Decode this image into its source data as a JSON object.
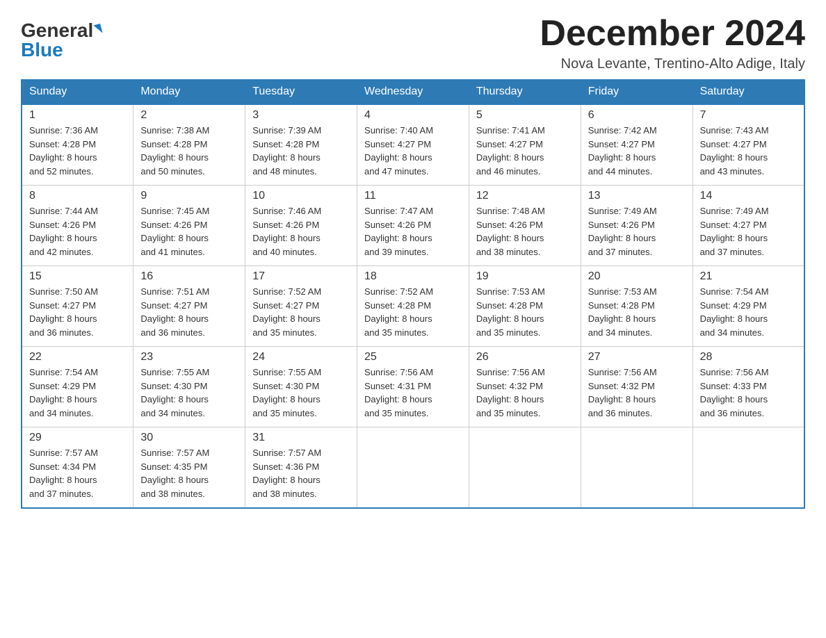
{
  "header": {
    "logo_general": "General",
    "logo_blue": "Blue",
    "month_title": "December 2024",
    "location": "Nova Levante, Trentino-Alto Adige, Italy"
  },
  "days_of_week": [
    "Sunday",
    "Monday",
    "Tuesday",
    "Wednesday",
    "Thursday",
    "Friday",
    "Saturday"
  ],
  "weeks": [
    [
      {
        "day": "1",
        "sunrise": "7:36 AM",
        "sunset": "4:28 PM",
        "daylight": "8 hours and 52 minutes."
      },
      {
        "day": "2",
        "sunrise": "7:38 AM",
        "sunset": "4:28 PM",
        "daylight": "8 hours and 50 minutes."
      },
      {
        "day": "3",
        "sunrise": "7:39 AM",
        "sunset": "4:28 PM",
        "daylight": "8 hours and 48 minutes."
      },
      {
        "day": "4",
        "sunrise": "7:40 AM",
        "sunset": "4:27 PM",
        "daylight": "8 hours and 47 minutes."
      },
      {
        "day": "5",
        "sunrise": "7:41 AM",
        "sunset": "4:27 PM",
        "daylight": "8 hours and 46 minutes."
      },
      {
        "day": "6",
        "sunrise": "7:42 AM",
        "sunset": "4:27 PM",
        "daylight": "8 hours and 44 minutes."
      },
      {
        "day": "7",
        "sunrise": "7:43 AM",
        "sunset": "4:27 PM",
        "daylight": "8 hours and 43 minutes."
      }
    ],
    [
      {
        "day": "8",
        "sunrise": "7:44 AM",
        "sunset": "4:26 PM",
        "daylight": "8 hours and 42 minutes."
      },
      {
        "day": "9",
        "sunrise": "7:45 AM",
        "sunset": "4:26 PM",
        "daylight": "8 hours and 41 minutes."
      },
      {
        "day": "10",
        "sunrise": "7:46 AM",
        "sunset": "4:26 PM",
        "daylight": "8 hours and 40 minutes."
      },
      {
        "day": "11",
        "sunrise": "7:47 AM",
        "sunset": "4:26 PM",
        "daylight": "8 hours and 39 minutes."
      },
      {
        "day": "12",
        "sunrise": "7:48 AM",
        "sunset": "4:26 PM",
        "daylight": "8 hours and 38 minutes."
      },
      {
        "day": "13",
        "sunrise": "7:49 AM",
        "sunset": "4:26 PM",
        "daylight": "8 hours and 37 minutes."
      },
      {
        "day": "14",
        "sunrise": "7:49 AM",
        "sunset": "4:27 PM",
        "daylight": "8 hours and 37 minutes."
      }
    ],
    [
      {
        "day": "15",
        "sunrise": "7:50 AM",
        "sunset": "4:27 PM",
        "daylight": "8 hours and 36 minutes."
      },
      {
        "day": "16",
        "sunrise": "7:51 AM",
        "sunset": "4:27 PM",
        "daylight": "8 hours and 36 minutes."
      },
      {
        "day": "17",
        "sunrise": "7:52 AM",
        "sunset": "4:27 PM",
        "daylight": "8 hours and 35 minutes."
      },
      {
        "day": "18",
        "sunrise": "7:52 AM",
        "sunset": "4:28 PM",
        "daylight": "8 hours and 35 minutes."
      },
      {
        "day": "19",
        "sunrise": "7:53 AM",
        "sunset": "4:28 PM",
        "daylight": "8 hours and 35 minutes."
      },
      {
        "day": "20",
        "sunrise": "7:53 AM",
        "sunset": "4:28 PM",
        "daylight": "8 hours and 34 minutes."
      },
      {
        "day": "21",
        "sunrise": "7:54 AM",
        "sunset": "4:29 PM",
        "daylight": "8 hours and 34 minutes."
      }
    ],
    [
      {
        "day": "22",
        "sunrise": "7:54 AM",
        "sunset": "4:29 PM",
        "daylight": "8 hours and 34 minutes."
      },
      {
        "day": "23",
        "sunrise": "7:55 AM",
        "sunset": "4:30 PM",
        "daylight": "8 hours and 34 minutes."
      },
      {
        "day": "24",
        "sunrise": "7:55 AM",
        "sunset": "4:30 PM",
        "daylight": "8 hours and 35 minutes."
      },
      {
        "day": "25",
        "sunrise": "7:56 AM",
        "sunset": "4:31 PM",
        "daylight": "8 hours and 35 minutes."
      },
      {
        "day": "26",
        "sunrise": "7:56 AM",
        "sunset": "4:32 PM",
        "daylight": "8 hours and 35 minutes."
      },
      {
        "day": "27",
        "sunrise": "7:56 AM",
        "sunset": "4:32 PM",
        "daylight": "8 hours and 36 minutes."
      },
      {
        "day": "28",
        "sunrise": "7:56 AM",
        "sunset": "4:33 PM",
        "daylight": "8 hours and 36 minutes."
      }
    ],
    [
      {
        "day": "29",
        "sunrise": "7:57 AM",
        "sunset": "4:34 PM",
        "daylight": "8 hours and 37 minutes."
      },
      {
        "day": "30",
        "sunrise": "7:57 AM",
        "sunset": "4:35 PM",
        "daylight": "8 hours and 38 minutes."
      },
      {
        "day": "31",
        "sunrise": "7:57 AM",
        "sunset": "4:36 PM",
        "daylight": "8 hours and 38 minutes."
      },
      null,
      null,
      null,
      null
    ]
  ],
  "labels": {
    "sunrise": "Sunrise:",
    "sunset": "Sunset:",
    "daylight": "Daylight:"
  }
}
